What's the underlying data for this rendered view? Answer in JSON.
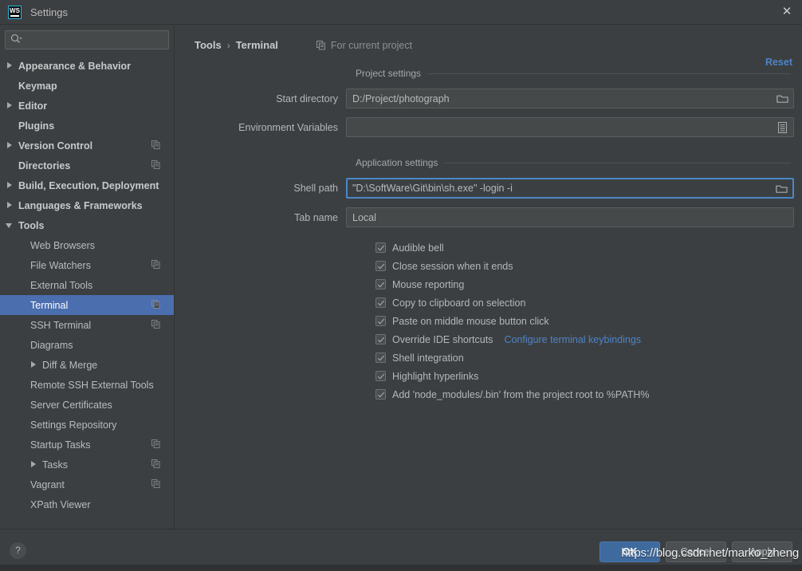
{
  "window": {
    "title": "Settings",
    "logo_text": "WS",
    "close_icon": "✕"
  },
  "search": {
    "placeholder": "",
    "value": "",
    "icon": "search-icon"
  },
  "sidebar": {
    "items": [
      {
        "label": "Appearance & Behavior",
        "level": 0,
        "arrow": "right",
        "bold": true,
        "badge": false,
        "selected": false
      },
      {
        "label": "Keymap",
        "level": 0,
        "arrow": "none",
        "bold": true,
        "badge": false,
        "selected": false
      },
      {
        "label": "Editor",
        "level": 0,
        "arrow": "right",
        "bold": true,
        "badge": false,
        "selected": false
      },
      {
        "label": "Plugins",
        "level": 0,
        "arrow": "none",
        "bold": true,
        "badge": false,
        "selected": false
      },
      {
        "label": "Version Control",
        "level": 0,
        "arrow": "right",
        "bold": true,
        "badge": true,
        "selected": false
      },
      {
        "label": "Directories",
        "level": 0,
        "arrow": "none",
        "bold": true,
        "badge": true,
        "selected": false
      },
      {
        "label": "Build, Execution, Deployment",
        "level": 0,
        "arrow": "right",
        "bold": true,
        "badge": false,
        "selected": false
      },
      {
        "label": "Languages & Frameworks",
        "level": 0,
        "arrow": "right",
        "bold": true,
        "badge": false,
        "selected": false
      },
      {
        "label": "Tools",
        "level": 0,
        "arrow": "down",
        "bold": true,
        "badge": false,
        "selected": false
      },
      {
        "label": "Web Browsers",
        "level": 1,
        "arrow": "none",
        "bold": false,
        "badge": false,
        "selected": false
      },
      {
        "label": "File Watchers",
        "level": 1,
        "arrow": "none",
        "bold": false,
        "badge": true,
        "selected": false
      },
      {
        "label": "External Tools",
        "level": 1,
        "arrow": "none",
        "bold": false,
        "badge": false,
        "selected": false
      },
      {
        "label": "Terminal",
        "level": 1,
        "arrow": "none",
        "bold": false,
        "badge": true,
        "selected": true
      },
      {
        "label": "SSH Terminal",
        "level": 1,
        "arrow": "none",
        "bold": false,
        "badge": true,
        "selected": false
      },
      {
        "label": "Diagrams",
        "level": 1,
        "arrow": "none",
        "bold": false,
        "badge": false,
        "selected": false
      },
      {
        "label": "Diff & Merge",
        "level": 1,
        "arrow": "right",
        "bold": false,
        "badge": false,
        "selected": false
      },
      {
        "label": "Remote SSH External Tools",
        "level": 1,
        "arrow": "none",
        "bold": false,
        "badge": false,
        "selected": false
      },
      {
        "label": "Server Certificates",
        "level": 1,
        "arrow": "none",
        "bold": false,
        "badge": false,
        "selected": false
      },
      {
        "label": "Settings Repository",
        "level": 1,
        "arrow": "none",
        "bold": false,
        "badge": false,
        "selected": false
      },
      {
        "label": "Startup Tasks",
        "level": 1,
        "arrow": "none",
        "bold": false,
        "badge": true,
        "selected": false
      },
      {
        "label": "Tasks",
        "level": 1,
        "arrow": "right",
        "bold": false,
        "badge": true,
        "selected": false
      },
      {
        "label": "Vagrant",
        "level": 1,
        "arrow": "none",
        "bold": false,
        "badge": true,
        "selected": false
      },
      {
        "label": "XPath Viewer",
        "level": 1,
        "arrow": "none",
        "bold": false,
        "badge": false,
        "selected": false
      }
    ]
  },
  "main": {
    "breadcrumb": {
      "parent": "Tools",
      "separator": "›",
      "current": "Terminal"
    },
    "scope_note": "For current project",
    "reset_label": "Reset",
    "groups": {
      "project": {
        "title": "Project settings",
        "fields": [
          {
            "label": "Start directory",
            "value": "D:/Project/photograph",
            "icon": "folder-icon",
            "focused": false
          },
          {
            "label": "Environment Variables",
            "value": "",
            "icon": "document-icon",
            "focused": false
          }
        ]
      },
      "application": {
        "title": "Application settings",
        "fields": [
          {
            "label": "Shell path",
            "value": "\"D:\\SoftWare\\Git\\bin\\sh.exe\" -login -i",
            "icon": "folder-icon",
            "focused": true
          },
          {
            "label": "Tab name",
            "value": "Local",
            "icon": "none",
            "focused": false
          }
        ]
      }
    },
    "checkboxes": [
      {
        "label": "Audible bell",
        "checked": true,
        "link": null
      },
      {
        "label": "Close session when it ends",
        "checked": true,
        "link": null
      },
      {
        "label": "Mouse reporting",
        "checked": true,
        "link": null
      },
      {
        "label": "Copy to clipboard on selection",
        "checked": true,
        "link": null
      },
      {
        "label": "Paste on middle mouse button click",
        "checked": true,
        "link": null
      },
      {
        "label": "Override IDE shortcuts",
        "checked": true,
        "link": "Configure terminal keybindings"
      },
      {
        "label": "Shell integration",
        "checked": true,
        "link": null
      },
      {
        "label": "Highlight hyperlinks",
        "checked": true,
        "link": null
      },
      {
        "label": "Add 'node_modules/.bin' from the project root to %PATH%",
        "checked": true,
        "link": null
      }
    ]
  },
  "footer": {
    "help_label": "?",
    "buttons": [
      {
        "label": "OK",
        "primary": true
      },
      {
        "label": "Cancel",
        "primary": false
      },
      {
        "label": "Apply",
        "primary": false
      }
    ],
    "watermark": "https://blog.csdn.net/marko_zheng"
  },
  "colors": {
    "window_bg": "#3c3f41",
    "selection_blue": "#4b6eaf",
    "link_blue": "#4d84c8",
    "focus_border": "#4a88c7",
    "primary_button": "#3f6a9e",
    "text": "#b4b7b9"
  }
}
